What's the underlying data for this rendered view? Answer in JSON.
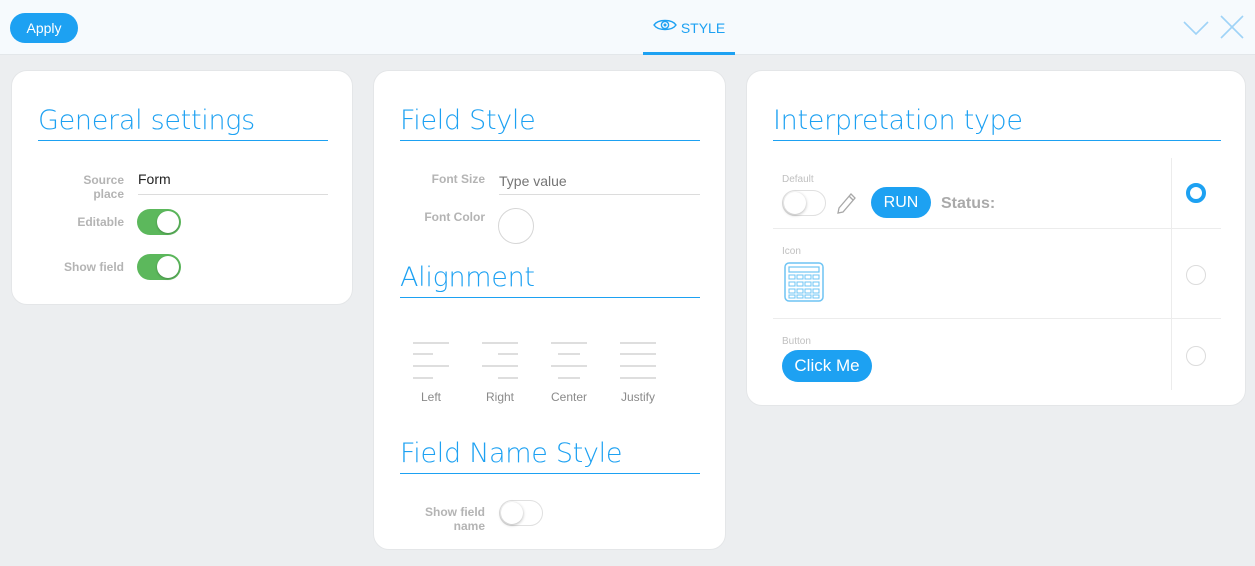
{
  "toolbar": {
    "apply_label": "Apply",
    "style_tab_label": "STYLE"
  },
  "general": {
    "title": "General settings",
    "source_place_label": "Source place",
    "source_place_value": "Form",
    "editable_label": "Editable",
    "editable_on": true,
    "show_field_label": "Show field",
    "show_field_on": true
  },
  "field_style": {
    "title": "Field Style",
    "font_size_label": "Font Size",
    "font_size_placeholder": "Type value",
    "font_color_label": "Font Color",
    "alignment_title": "Alignment",
    "alignments": [
      "Left",
      "Right",
      "Center",
      "Justify"
    ],
    "field_name_title": "Field Name Style",
    "show_field_name_label": "Show field name",
    "show_field_name_on": false
  },
  "interpretation": {
    "title": "Interpretation type",
    "default_label": "Default",
    "run_label": "RUN",
    "status_label": "Status:",
    "icon_label": "Icon",
    "button_label": "Button",
    "click_me_label": "Click Me",
    "selected": "Default"
  },
  "colors": {
    "accent": "#1da1f2",
    "toggle_on": "#5cb85c"
  },
  "icons": [
    "eye-icon",
    "chevron-down-icon",
    "close-icon",
    "pencil-icon",
    "calculator-icon"
  ]
}
